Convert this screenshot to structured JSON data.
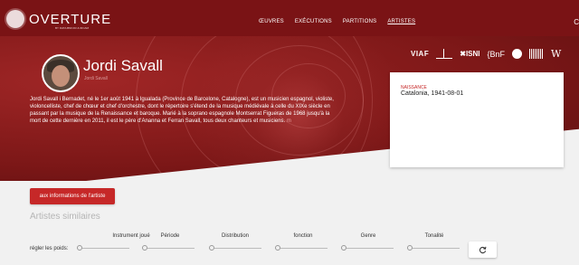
{
  "header": {
    "logo_text": "OVERTURE",
    "logo_sub": "BY DATA.BNF.FR & IRCAM",
    "nav": [
      "ŒUVRES",
      "EXÉCUTIONS",
      "PARTITIONS",
      "ARTISTES"
    ],
    "active_nav": "ARTISTES",
    "right_glyph": "C"
  },
  "artist": {
    "name": "Jordi Savall",
    "subname": "Jordi Savall",
    "bio": "Jordi Savall i Bernadet, né le 1er août 1941 à Igualada (Province de Barcelone, Catalogne), est un musicien espagnol, violiste, violoncelliste, chef de chœur et chef d'orchestre, dont le répertoire s'étend de la musique médiévale à celle du XIXe siècle en passant par la musique de la Renaissance et baroque. Marié à la soprano espagnole Montserrat Figueras de 1968 jusqu'à la mort de cette dernière en 2011, il est le père d'Ananna et Ferran Savall, tous deux chanteurs et musiciens.",
    "bio_more": "m"
  },
  "identifiers": {
    "viaf": "VIAF",
    "isni": "ISNI",
    "bnf": "BnF",
    "wikipedia": "W"
  },
  "birth_card": {
    "label": "NAISSANCE",
    "value": "Catalonia, 1941-08-01"
  },
  "actions": {
    "artist_info_button": "aux informations de l'artiste"
  },
  "similar": {
    "title": "Artistes similaires",
    "weights_label": "régler les poids:",
    "columns": [
      "Instrument joué",
      "Période",
      "Distribution",
      "fonction",
      "Genre",
      "Tonalité"
    ]
  },
  "colors": {
    "accent": "#c62828",
    "header_bg": "#7a1315"
  }
}
